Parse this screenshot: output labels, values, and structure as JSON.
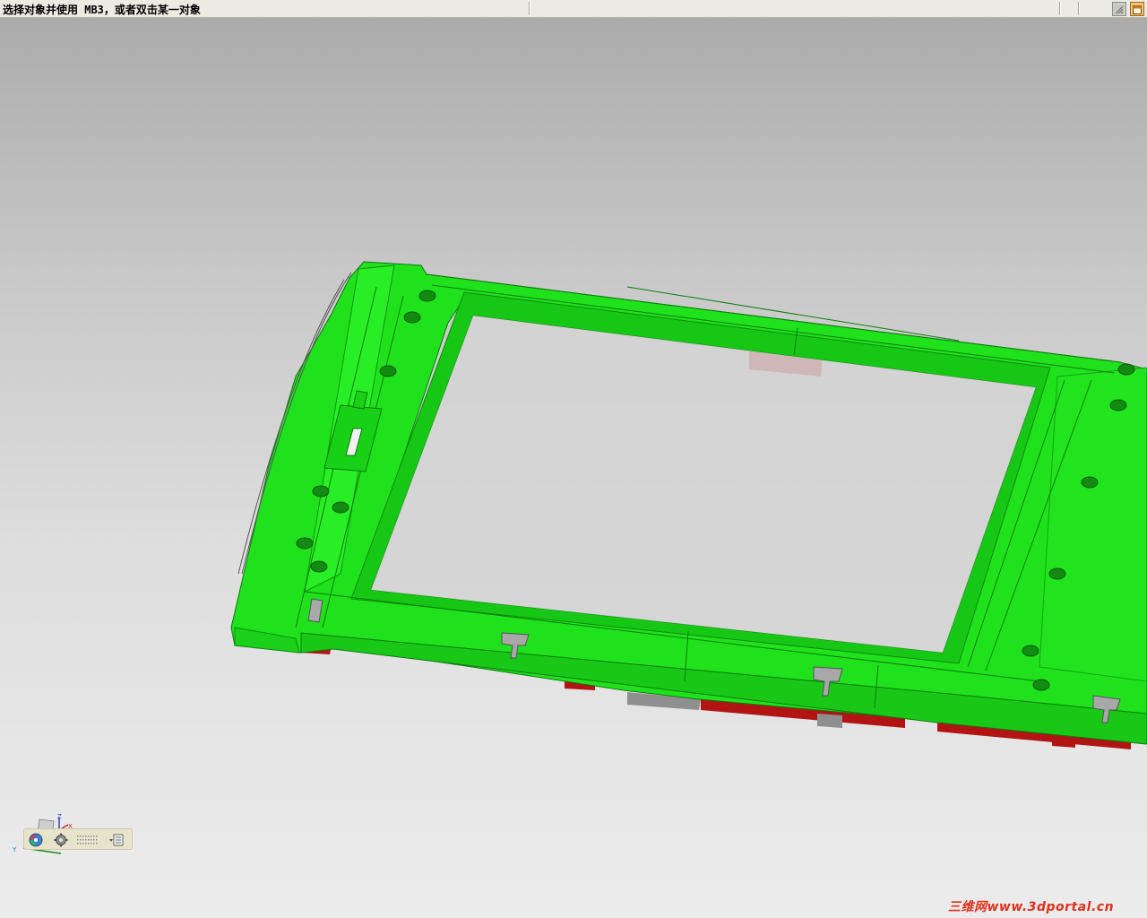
{
  "status_bar": {
    "prompt": "选择对象并使用 MB3，或者双击某一对象"
  },
  "triad": {
    "axis_x": "X",
    "axis_y": "Y",
    "axis_z": "Z"
  },
  "view_toolbar": {
    "icons": [
      "orient-view-icon",
      "settings-gear-icon",
      "grid-dots-icon",
      "list-menu-icon"
    ]
  },
  "watermark": {
    "text": "三维网www.3dportal.cn"
  },
  "colors": {
    "part_green": "#1fe21d",
    "part_red": "#b21414",
    "background_top": "#a9a9a9",
    "background_bottom": "#ececec",
    "statusbar": "#ecebe3",
    "watermark": "#e0301d"
  }
}
